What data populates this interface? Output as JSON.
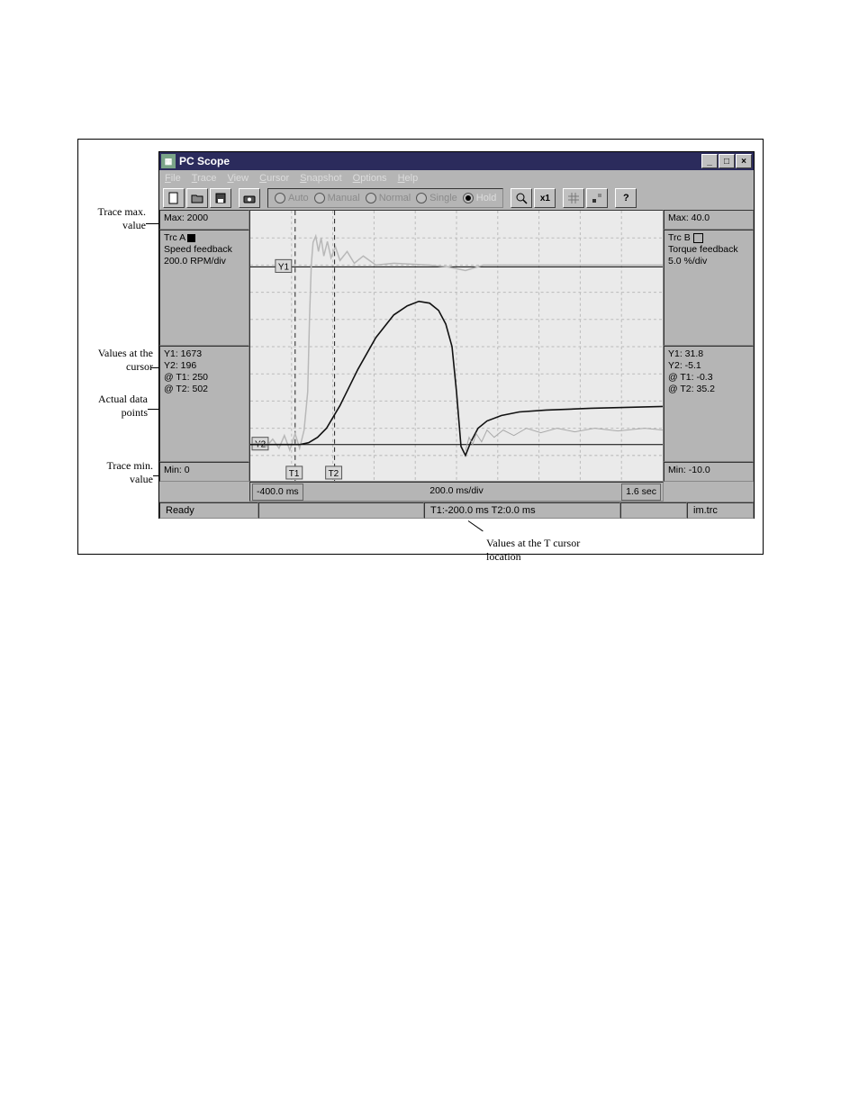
{
  "window": {
    "title": "PC Scope"
  },
  "menu": {
    "file": "File",
    "trace": "Trace",
    "view": "View",
    "cursor": "Cursor",
    "snapshot": "Snapshot",
    "options": "Options",
    "help": "Help"
  },
  "toolbar": {
    "mode_auto": "Auto",
    "mode_manual": "Manual",
    "mode_normal": "Normal",
    "mode_single": "Single",
    "mode_hold": "Hold",
    "zoom_label": "x1"
  },
  "traceA": {
    "label": "Trc A",
    "name": "Speed feedback",
    "scale": "200.0 RPM/div",
    "max": "Max: 2000",
    "min": "Min: 0",
    "y1": "Y1: 1673",
    "y2": "Y2: 196",
    "t1": "@ T1: 250",
    "t2": "@ T2: 502"
  },
  "traceB": {
    "label": "Trc B",
    "name": "Torque feedback",
    "scale": "5.0 %/div",
    "max": "Max: 40.0",
    "min": "Min: -10.0",
    "y1": "Y1: 31.8",
    "y2": "Y2: -5.1",
    "t1": "@ T1: -0.3",
    "t2": "@ T2: 35.2"
  },
  "time": {
    "start": "-400.0 ms",
    "div": "200.0 ms/div",
    "end": "1.6 sec"
  },
  "status": {
    "ready": "Ready",
    "cursor": "T1:-200.0 ms  T2:0.0 ms",
    "file": "im.trc"
  },
  "annotations": {
    "trace_max": "Trace max. value",
    "values_at_cursor": "Values at the cursor",
    "actual_data": "Actual data points",
    "trace_min": "Trace min. value",
    "t_cursor": "Values at the T cursor location"
  },
  "cursors": {
    "y1": "Y1",
    "y2": "Y2",
    "t1": "T1",
    "t2": "T2"
  }
}
